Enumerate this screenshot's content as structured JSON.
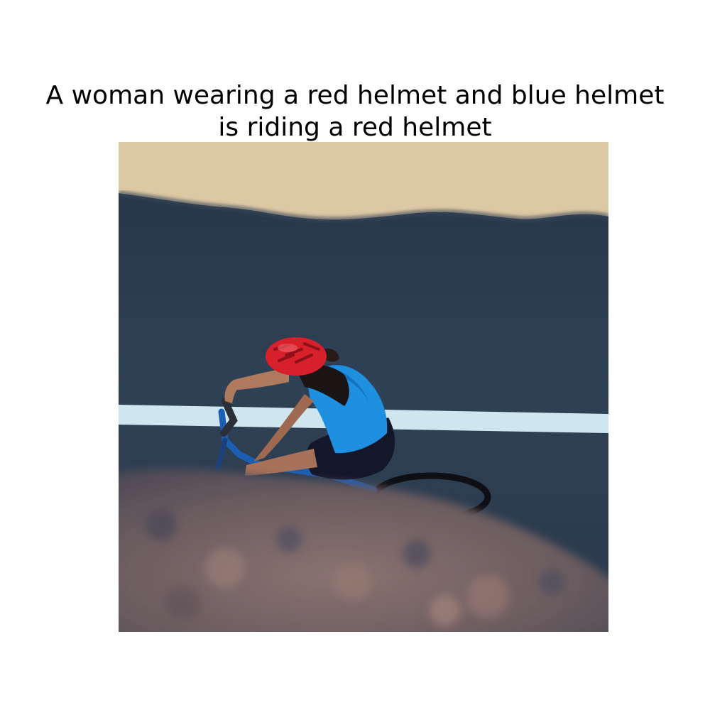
{
  "caption": {
    "line1": "A woman wearing a red helmet and blue helmet",
    "line2": "is riding a red helmet"
  },
  "photo": {
    "scene_elements": [
      "sand-strip",
      "asphalt-road",
      "lane-line",
      "cyclist",
      "bicycle",
      "blurred-rock"
    ],
    "colors": {
      "sand": "#ddc8a4",
      "asphalt": "#2e3f52",
      "lane_line": "#cfe6ee",
      "helmet": "#d8202c",
      "shirt": "#1f8fe0",
      "shorts": "#14162a",
      "skin": "#b07a5e",
      "rock": "#7f6a68"
    }
  }
}
